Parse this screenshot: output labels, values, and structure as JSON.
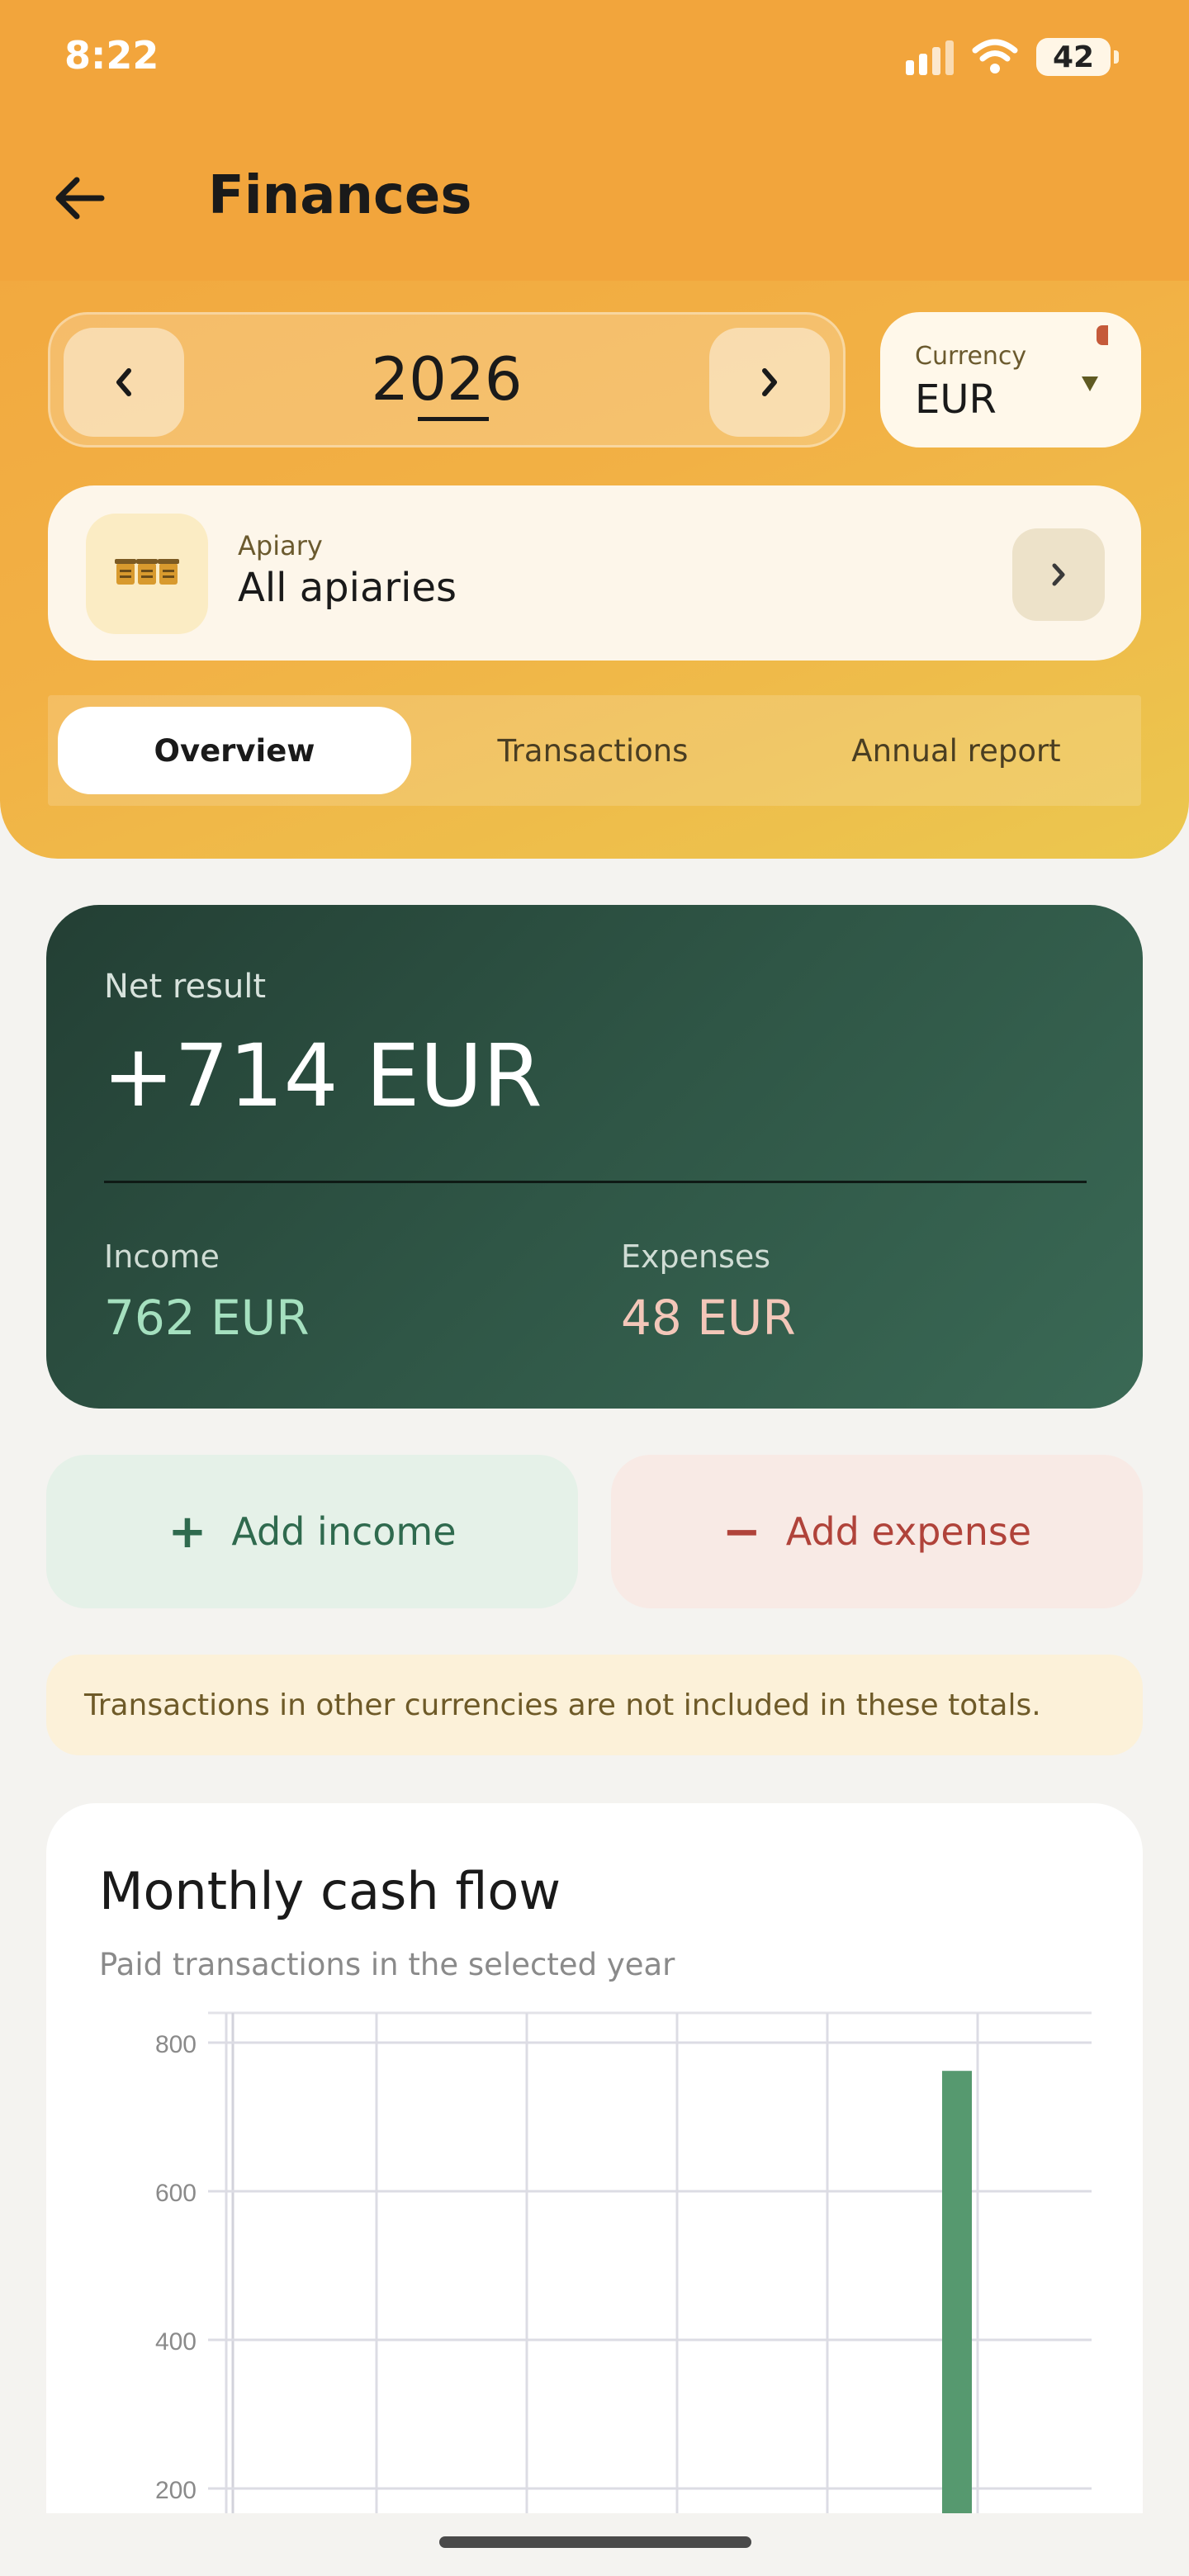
{
  "status_bar": {
    "time": "8:22",
    "battery": "42"
  },
  "header": {
    "title": "Finances"
  },
  "year_selector": {
    "year": "2026"
  },
  "currency": {
    "label": "Currency",
    "value": "EUR"
  },
  "apiary": {
    "label": "Apiary",
    "value": "All apiaries"
  },
  "tabs": [
    {
      "label": "Overview",
      "active": true
    },
    {
      "label": "Transactions",
      "active": false
    },
    {
      "label": "Annual report",
      "active": false
    }
  ],
  "summary": {
    "net_label": "Net result",
    "net_value": "+714 EUR",
    "income_label": "Income",
    "income_value": "762 EUR",
    "expenses_label": "Expenses",
    "expenses_value": "48 EUR"
  },
  "actions": {
    "add_income": "Add income",
    "add_expense": "Add expense"
  },
  "notice": "Transactions in other currencies are not included in these totals.",
  "colors": {
    "accent": "#f2a53c",
    "net_card": "#2f5646",
    "income": "#a5e0bf",
    "expense": "#f3c7b9",
    "bar": "#56996f"
  },
  "chart_data": {
    "type": "bar",
    "title": "Monthly cash flow",
    "subtitle": "Paid transactions in the selected year",
    "y_ticks": [
      200,
      400,
      600,
      800
    ],
    "ylim": [
      0,
      850
    ],
    "grid": true,
    "series": [
      {
        "values": [
          0,
          0,
          0,
          0,
          0,
          0,
          0,
          0,
          0,
          762,
          0,
          0
        ]
      }
    ]
  }
}
